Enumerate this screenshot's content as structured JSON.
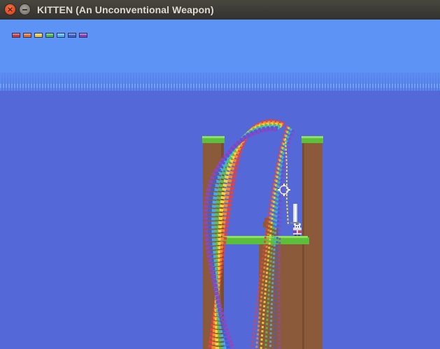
{
  "window": {
    "title": "KITTEN (An Unconventional Weapon)",
    "close_glyph": "×"
  },
  "icons": [
    "close-icon",
    "minimize-icon",
    "pixel-sword-icon",
    "crosshair-icon",
    "kitten-icon"
  ],
  "colors": {
    "sky_top": "#5c93f4",
    "sky_bottom": "#5468d8",
    "dirt": "#8b5a3a",
    "grass": "#5bbf3c",
    "grass_light": "#8ee05d"
  },
  "inventory": [
    {
      "name": "red",
      "color": "#c63b3b"
    },
    {
      "name": "orange",
      "color": "#d9702d"
    },
    {
      "name": "yellow",
      "color": "#e3c93b"
    },
    {
      "name": "green",
      "color": "#4bb84b"
    },
    {
      "name": "cyan",
      "color": "#4fb1e6"
    },
    {
      "name": "blue",
      "color": "#3b63c9"
    },
    {
      "name": "violet",
      "color": "#8a3fb5"
    }
  ],
  "rainbow_colors": [
    "#e64040",
    "#f08a2e",
    "#f5d33b",
    "#57c24e",
    "#49aee8",
    "#3c5fd6",
    "#9046c0"
  ]
}
